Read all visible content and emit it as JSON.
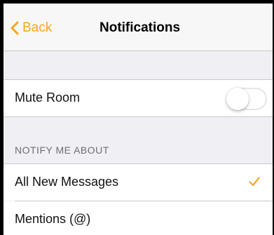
{
  "navbar": {
    "back_label": "Back",
    "title": "Notifications"
  },
  "settings": {
    "mute_room": {
      "label": "Mute Room",
      "enabled": false
    },
    "notify_section": {
      "header": "NOTIFY ME ABOUT",
      "options": [
        {
          "label": "All New Messages",
          "selected": true
        },
        {
          "label": "Mentions (@)",
          "selected": false
        }
      ]
    }
  },
  "colors": {
    "accent": "#f5a623",
    "background": "#efeff4",
    "row": "#ffffff",
    "separator": "#c8c7cc",
    "section_header": "#6d6d72"
  },
  "icons": {
    "back": "chevron-left-icon",
    "check": "checkmark-icon"
  }
}
